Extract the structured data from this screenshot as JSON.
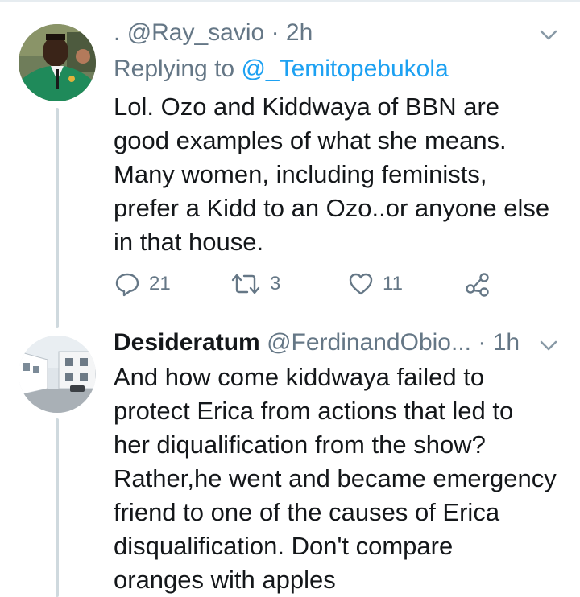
{
  "tweets": [
    {
      "dot": ".",
      "handle": "@Ray_savio",
      "sep": "·",
      "time": "2h",
      "reply_prefix": "Replying to",
      "reply_to": "@_Temitopebukola",
      "lines": [
        "Lol. Ozo and Kiddwaya of BBN are",
        "good examples of what she means.",
        "Many women, including feminists,",
        "prefer a Kidd to an Ozo..or anyone else",
        "in that house."
      ],
      "actions": {
        "replies": "21",
        "retweets": "3",
        "likes": "11"
      }
    },
    {
      "name": "Desideratum",
      "handle": "@FerdinandObio...",
      "sep": "·",
      "time": "1h",
      "lines": [
        "And how come kiddwaya failed to",
        "protect Erica from actions that led to",
        "her diqualification from the show?",
        "Rather,he went and became emergency",
        "friend to one of the causes of Erica",
        "disqualification. Don't compare",
        "oranges with apples"
      ]
    }
  ],
  "icons": {
    "caret": "chevron-down-icon",
    "reply": "reply-icon",
    "retweet": "retweet-icon",
    "like": "heart-icon",
    "share": "share-icon"
  },
  "colors": {
    "link": "#1da1f2",
    "muted": "#657786",
    "text": "#14171a",
    "line": "#cfd9de"
  }
}
